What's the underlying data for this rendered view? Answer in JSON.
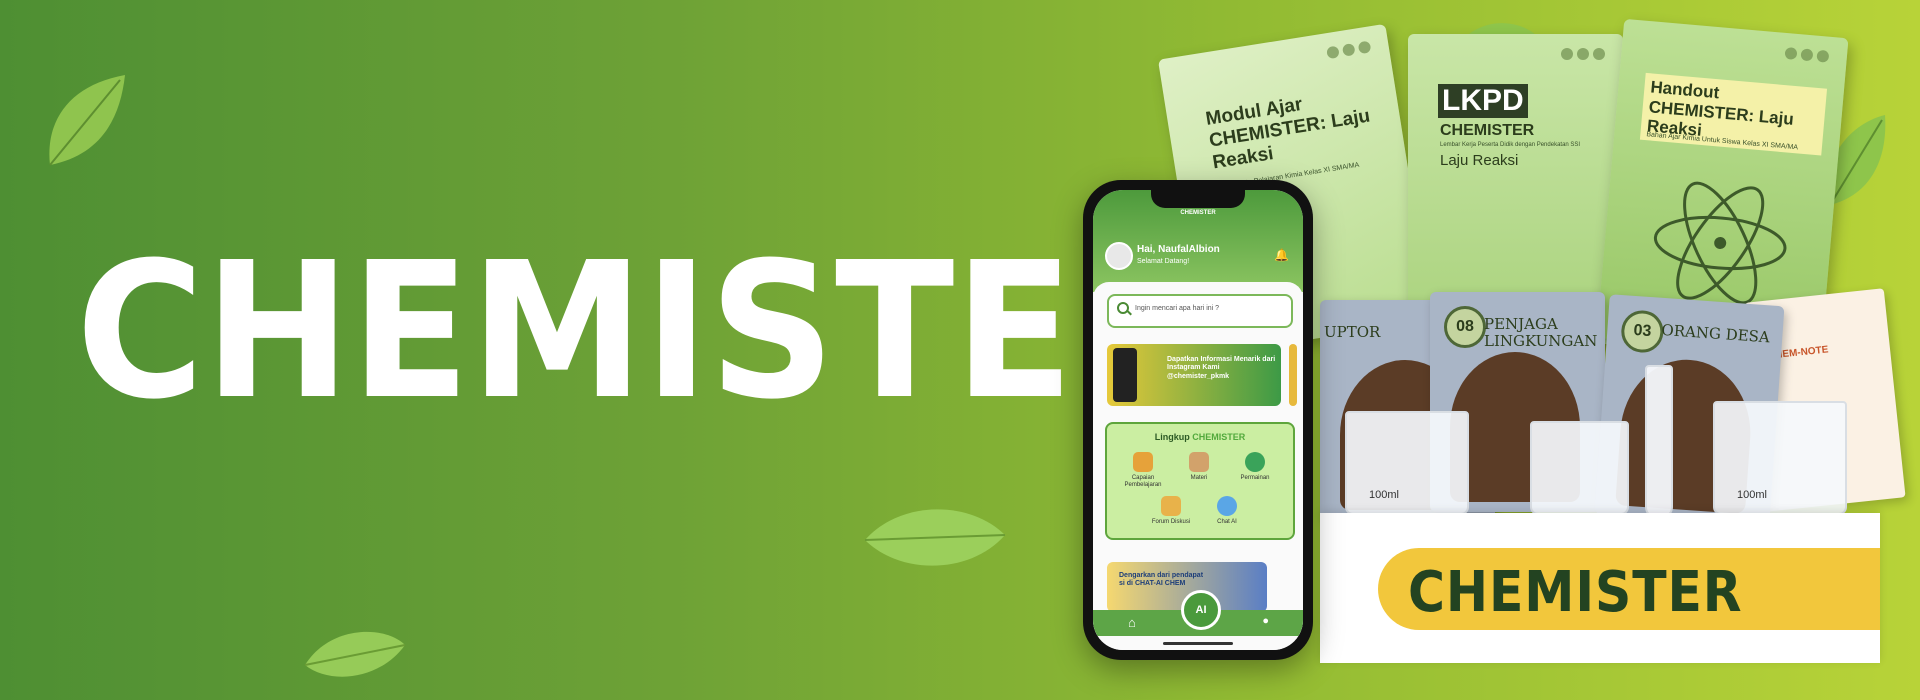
{
  "hero": {
    "title": "CHEMISTER"
  },
  "books": [
    {
      "title": "Modul Ajar CHEMISTER: Laju Reaksi",
      "subtitle": "Untuk Mata Pelajaran Kimia Kelas XI SMA/MA"
    },
    {
      "title": "LKPD",
      "title2": "CHEMISTER",
      "subtitle": "Lembar Kerja Peserta Didik dengan Pendekatan SSI",
      "topic": "Laju Reaksi"
    },
    {
      "title": "Handout CHEMISTER: Laju Reaksi",
      "subtitle": "Bahan Ajar Kimia Untuk Siswa Kelas XI SMA/MA"
    }
  ],
  "cards": [
    {
      "number": "",
      "title": "UPTOR"
    },
    {
      "number": "08",
      "title": "PENJAGA LINGKUNGAN"
    },
    {
      "number": "03",
      "title": "ORANG DESA"
    }
  ],
  "notebook": {
    "title": "CHEM-NOTE"
  },
  "beakers": [
    {
      "label": "100ml"
    },
    {
      "label": ""
    },
    {
      "label": "100ml"
    }
  ],
  "box": {
    "label": "CHEMISTER"
  },
  "phone": {
    "app_name": "CHEMISTER",
    "greeting": "Hai, NaufalAlbion",
    "subgreeting": "Selamat Datang!",
    "search_placeholder": "Ingin mencari apa hari ini ?",
    "banner_text": "Dapatkan Informasi Menarik dari Instagram Kami @chemister_pkmk",
    "scope_title_prefix": "Lingkup",
    "scope_title_brand": "CHEMISTER",
    "features": [
      {
        "label": "Capaian Pembelajaran",
        "icon": "target-icon"
      },
      {
        "label": "Materi",
        "icon": "book-icon"
      },
      {
        "label": "Permainan",
        "icon": "gamepad-icon"
      },
      {
        "label": "Forum Diskusi",
        "icon": "people-icon"
      },
      {
        "label": "Chat AI",
        "icon": "chat-ai-icon"
      }
    ],
    "promo_text": "Dengarkan dari pendapat si di CHAT-AI CHEM",
    "fab_label": "AI"
  },
  "colors": {
    "accent": "#5da547",
    "box_label": "#f2c73c",
    "box_text": "#234321"
  }
}
